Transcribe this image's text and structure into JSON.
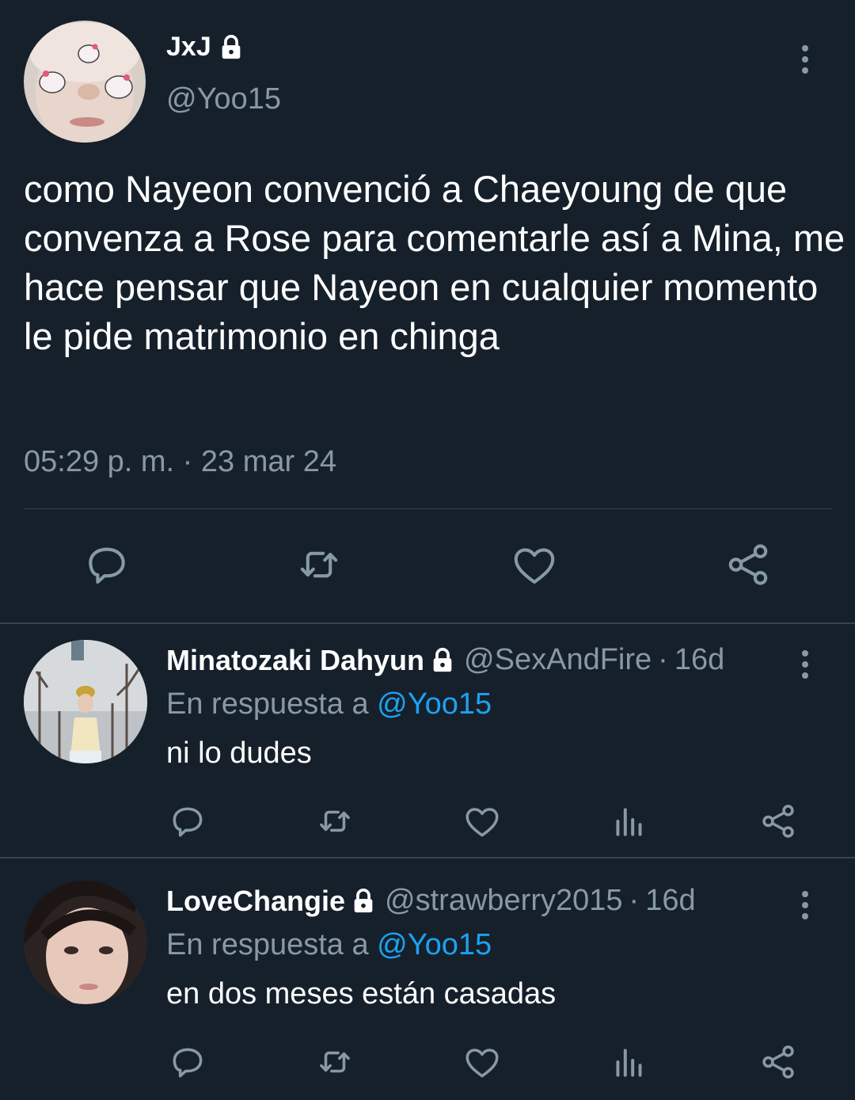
{
  "tweet": {
    "display_name": "JxJ",
    "handle": "@Yoo15",
    "text": "como Nayeon convenció a Chaeyoung de que convenza a Rose para comentarle así a Mina, me hace pensar que Nayeon en cualquier momento le pide matrimonio en chinga",
    "timestamp": "05:29 p. m. · 23 mar 24",
    "actions": [
      "reply-icon",
      "retweet-icon",
      "like-icon",
      "share-icon"
    ]
  },
  "replies": [
    {
      "display_name": "Minatozaki Dahyun",
      "handle": "@SexAndFire",
      "separator": "·",
      "time": "16d",
      "reply_prefix": "En respuesta a",
      "reply_to": "@Yoo15",
      "text": "ni lo dudes",
      "actions": [
        "reply-icon",
        "retweet-icon",
        "like-icon",
        "analytics-icon",
        "share-icon"
      ]
    },
    {
      "display_name": "LoveChangie",
      "handle": "@strawberry2015",
      "separator": "·",
      "time": "16d",
      "reply_prefix": "En respuesta a",
      "reply_to": "@Yoo15",
      "text": "en dos meses están casadas",
      "actions": [
        "reply-icon",
        "retweet-icon",
        "like-icon",
        "analytics-icon",
        "share-icon"
      ]
    }
  ],
  "colors": {
    "background": "#15202b",
    "secondary_text": "#8899a6",
    "accent": "#1da1f2",
    "divider": "#38444d"
  }
}
